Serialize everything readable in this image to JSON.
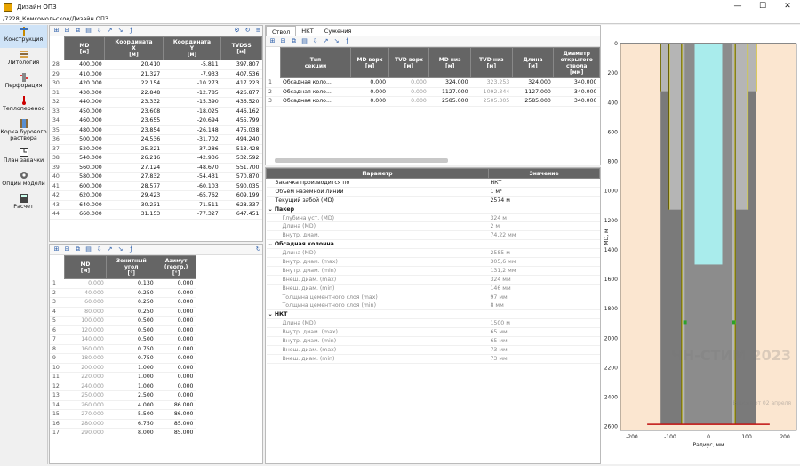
{
  "window": {
    "title": "Дизайн ОПЗ",
    "minimize": "—",
    "maximize": "☐",
    "close": "✕"
  },
  "path": "/7228_Комсомольское/Дизайн ОПЗ",
  "nav": [
    {
      "label": "Конструкция",
      "icon": "drill-icon",
      "active": true
    },
    {
      "label": "Литология",
      "icon": "layers-icon"
    },
    {
      "label": "Перфорация",
      "icon": "perforation-icon"
    },
    {
      "label": "Теплоперенос",
      "icon": "heat-icon"
    },
    {
      "label": "Корка бурового раствора",
      "icon": "mud-icon"
    },
    {
      "label": "План закачки",
      "icon": "schedule-icon"
    },
    {
      "label": "Опции модели",
      "icon": "options-icon"
    },
    {
      "label": "Расчет",
      "icon": "calculator-icon"
    }
  ],
  "traj": {
    "headers": [
      "MD\n[м]",
      "Координата\nX\n[м]",
      "Координата\nY\n[м]",
      "TVDSS\n[м]"
    ],
    "rows": [
      [
        "28",
        "400.000",
        "20.410",
        "-5.811",
        "397.807"
      ],
      [
        "29",
        "410.000",
        "21.327",
        "-7.933",
        "407.536"
      ],
      [
        "30",
        "420.000",
        "22.154",
        "-10.273",
        "417.223"
      ],
      [
        "31",
        "430.000",
        "22.848",
        "-12.785",
        "426.877"
      ],
      [
        "32",
        "440.000",
        "23.332",
        "-15.390",
        "436.520"
      ],
      [
        "33",
        "450.000",
        "23.608",
        "-18.025",
        "446.162"
      ],
      [
        "34",
        "460.000",
        "23.655",
        "-20.694",
        "455.799"
      ],
      [
        "35",
        "480.000",
        "23.854",
        "-26.148",
        "475.038"
      ],
      [
        "36",
        "500.000",
        "24.536",
        "-31.702",
        "494.240"
      ],
      [
        "37",
        "520.000",
        "25.321",
        "-37.286",
        "513.428"
      ],
      [
        "38",
        "540.000",
        "26.216",
        "-42.936",
        "532.592"
      ],
      [
        "39",
        "560.000",
        "27.124",
        "-48.670",
        "551.700"
      ],
      [
        "40",
        "580.000",
        "27.832",
        "-54.431",
        "570.870"
      ],
      [
        "41",
        "600.000",
        "28.577",
        "-60.103",
        "590.035"
      ],
      [
        "42",
        "620.000",
        "29.423",
        "-65.762",
        "609.199"
      ],
      [
        "43",
        "640.000",
        "30.231",
        "-71.511",
        "628.337"
      ],
      [
        "44",
        "660.000",
        "31.153",
        "-77.327",
        "647.451"
      ]
    ]
  },
  "incl": {
    "headers": [
      "MD\n[м]",
      "Зенитный\nугол\n[°]",
      "Азимут\n(геогр.)\n[°]"
    ],
    "rows": [
      [
        "1",
        "0.000",
        "0.130",
        "0.000"
      ],
      [
        "2",
        "40.000",
        "0.250",
        "0.000"
      ],
      [
        "3",
        "60.000",
        "0.250",
        "0.000"
      ],
      [
        "4",
        "80.000",
        "0.250",
        "0.000"
      ],
      [
        "5",
        "100.000",
        "0.500",
        "0.000"
      ],
      [
        "6",
        "120.000",
        "0.500",
        "0.000"
      ],
      [
        "7",
        "140.000",
        "0.500",
        "0.000"
      ],
      [
        "8",
        "160.000",
        "0.750",
        "0.000"
      ],
      [
        "9",
        "180.000",
        "0.750",
        "0.000"
      ],
      [
        "10",
        "200.000",
        "1.000",
        "0.000"
      ],
      [
        "11",
        "220.000",
        "1.000",
        "0.000"
      ],
      [
        "12",
        "240.000",
        "1.000",
        "0.000"
      ],
      [
        "13",
        "250.000",
        "2.500",
        "0.000"
      ],
      [
        "14",
        "260.000",
        "4.000",
        "86.000"
      ],
      [
        "15",
        "270.000",
        "5.500",
        "86.000"
      ],
      [
        "16",
        "280.000",
        "6.750",
        "85.000"
      ],
      [
        "17",
        "290.000",
        "8.000",
        "85.000"
      ]
    ]
  },
  "tabs": [
    "Ствол",
    "НКТ",
    "Сужения"
  ],
  "sections": {
    "headers": [
      "Тип\nсекции",
      "MD верх\n[м]",
      "TVD верх\n[м]",
      "MD низ\n[м]",
      "TVD низ\n[м]",
      "Длина\n[м]",
      "Диаметр\nоткрытого\nствола\n[мм]"
    ],
    "rows": [
      [
        "1",
        "Обсадная коло...",
        "0.000",
        "0.000",
        "324.000",
        "323.253",
        "324.000",
        "340.000"
      ],
      [
        "2",
        "Обсадная коло...",
        "0.000",
        "0.000",
        "1127.000",
        "1092.344",
        "1127.000",
        "340.000"
      ],
      [
        "3",
        "Обсадная коло...",
        "0.000",
        "0.000",
        "2585.000",
        "2505.305",
        "2585.000",
        "340.000"
      ]
    ]
  },
  "params": {
    "headers": [
      "Параметр",
      "Значение"
    ],
    "rows": [
      {
        "name": "Закачка производится по",
        "value": "НКТ",
        "kind": "item"
      },
      {
        "name": "Объём наземной линии",
        "value": "1 м³",
        "kind": "item"
      },
      {
        "name": "Текущий забой (MD)",
        "value": "2574 м",
        "kind": "item"
      },
      {
        "name": "Пакер",
        "value": "",
        "kind": "group"
      },
      {
        "name": "Глубина уст. (MD)",
        "value": "324 м",
        "kind": "sub"
      },
      {
        "name": "Длина (MD)",
        "value": "2 м",
        "kind": "sub"
      },
      {
        "name": "Внутр. диам.",
        "value": "74,22 мм",
        "kind": "sub"
      },
      {
        "name": "Обсадная колонна",
        "value": "",
        "kind": "group"
      },
      {
        "name": "Длина (MD)",
        "value": "2585 м",
        "kind": "sub"
      },
      {
        "name": "Внутр. диам. (max)",
        "value": "305,6 мм",
        "kind": "sub"
      },
      {
        "name": "Внутр. диам. (min)",
        "value": "131,2 мм",
        "kind": "sub"
      },
      {
        "name": "Внеш. диам. (max)",
        "value": "324 мм",
        "kind": "sub"
      },
      {
        "name": "Внеш. диам. (min)",
        "value": "146 мм",
        "kind": "sub"
      },
      {
        "name": "Толщина цементного слоя (max)",
        "value": "97 мм",
        "kind": "sub"
      },
      {
        "name": "Толщина цементного слоя (min)",
        "value": "8 мм",
        "kind": "sub"
      },
      {
        "name": "НКТ",
        "value": "",
        "kind": "group"
      },
      {
        "name": "Длина (MD)",
        "value": "1500 м",
        "kind": "sub"
      },
      {
        "name": "Внутр. диам. (max)",
        "value": "65 мм",
        "kind": "sub"
      },
      {
        "name": "Внутр. диам. (min)",
        "value": "65 мм",
        "kind": "sub"
      },
      {
        "name": "Внеш. диам. (max)",
        "value": "73 мм",
        "kind": "sub"
      },
      {
        "name": "Внеш. диам. (min)",
        "value": "73 мм",
        "kind": "sub"
      }
    ]
  },
  "chart_data": {
    "type": "diagram",
    "ylabel": "MD, м",
    "xlabel": "Радиус, мм",
    "yticks": [
      "0",
      "200",
      "400",
      "600",
      "800",
      "1000",
      "1200",
      "1400",
      "1600",
      "1800",
      "2000",
      "2200",
      "2400",
      "2600"
    ],
    "xticks": [
      "-200",
      "-100",
      "0",
      "100",
      "200"
    ],
    "watermark": "ЧН-СТИМ 2023",
    "version_note": "Версия от 02 апреля",
    "colors": {
      "formation": "#fbe6d0",
      "casing": "#7a7a7a",
      "cement": "#b5b5b5",
      "fluid": "#a9ecec",
      "shoe": "#e6d800",
      "bottom": "#c01010"
    }
  }
}
